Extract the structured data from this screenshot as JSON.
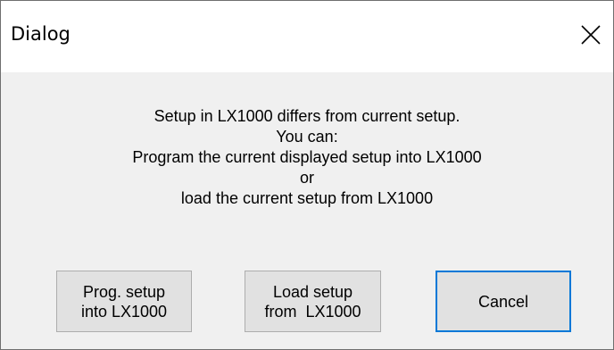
{
  "window": {
    "title": "Dialog",
    "close_icon": "close-x-icon"
  },
  "message": {
    "lines": [
      "Setup in LX1000 differs from current setup.",
      "You can:",
      "Program the current displayed setup into LX1000",
      "or",
      "load the current setup from LX1000"
    ]
  },
  "buttons": {
    "prog_setup": {
      "line1": "Prog. setup",
      "line2": "into LX1000"
    },
    "load_setup": {
      "line1": "Load setup",
      "line2": "from  LX1000"
    },
    "cancel": {
      "label": "Cancel"
    }
  },
  "colors": {
    "titlebar_bg": "#ffffff",
    "dialog_bg": "#f0f0f0",
    "button_bg": "#e1e1e1",
    "focus_border": "#0078d7"
  }
}
